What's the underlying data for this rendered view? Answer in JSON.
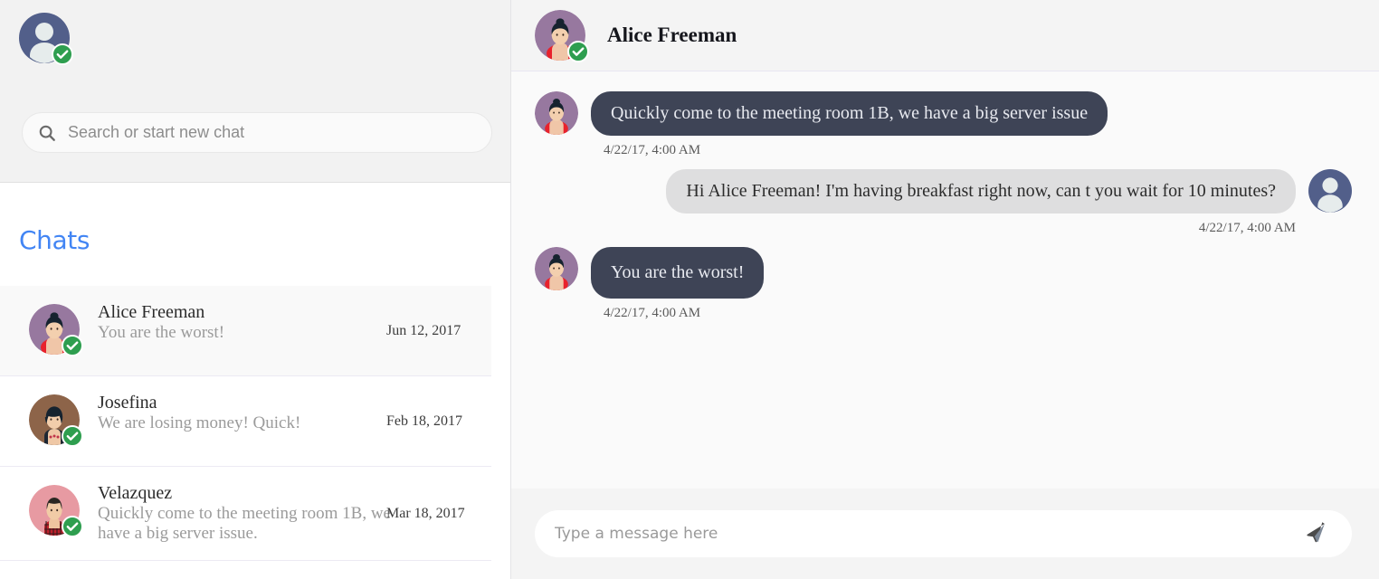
{
  "sidebar": {
    "me": {
      "avatar": "default-user-avatar",
      "status": "online",
      "status_icon": "check-badge-icon"
    },
    "search": {
      "placeholder": "Search or start new chat",
      "value": "",
      "icon": "search-icon"
    },
    "chats_heading": "Chats",
    "chats": [
      {
        "name": "Alice Freeman",
        "snippet": "You are the worst!",
        "date": "Jun 12, 2017",
        "avatar": "alice-avatar",
        "selected": true,
        "status_icon": "check-badge-icon"
      },
      {
        "name": "Josefina",
        "snippet": "We are losing money! Quick!",
        "date": "Feb 18, 2017",
        "avatar": "josefina-avatar",
        "selected": false,
        "status_icon": "check-badge-icon"
      },
      {
        "name": "Velazquez",
        "snippet": "Quickly come to the meeting room 1B, we have a big server issue.",
        "date": "Mar 18, 2017",
        "avatar": "velazquez-avatar",
        "selected": false,
        "status_icon": "check-badge-icon"
      }
    ]
  },
  "conversation": {
    "header": {
      "name": "Alice Freeman",
      "avatar": "alice-avatar",
      "status_icon": "check-badge-icon"
    },
    "messages": [
      {
        "direction": "in",
        "text": "Quickly come to the meeting room 1B, we have a big server issue",
        "time": "4/22/17, 4:00 AM",
        "avatar": "alice-avatar"
      },
      {
        "direction": "out",
        "text": "Hi Alice Freeman! I'm having breakfast right now, can t you wait for 10 minutes?",
        "time": "4/22/17, 4:00 AM",
        "avatar": "default-user-avatar"
      },
      {
        "direction": "in",
        "text": "You are the worst!",
        "time": "4/22/17, 4:00 AM",
        "avatar": "alice-avatar"
      }
    ],
    "composer": {
      "placeholder": "Type a message here",
      "value": "",
      "send_icon": "send-paper-plane-icon"
    }
  },
  "colors": {
    "accent": "#4285f4",
    "incoming_bubble": "#3e4456",
    "outgoing_bubble": "#dededf",
    "online_badge": "#2e9e4f"
  }
}
